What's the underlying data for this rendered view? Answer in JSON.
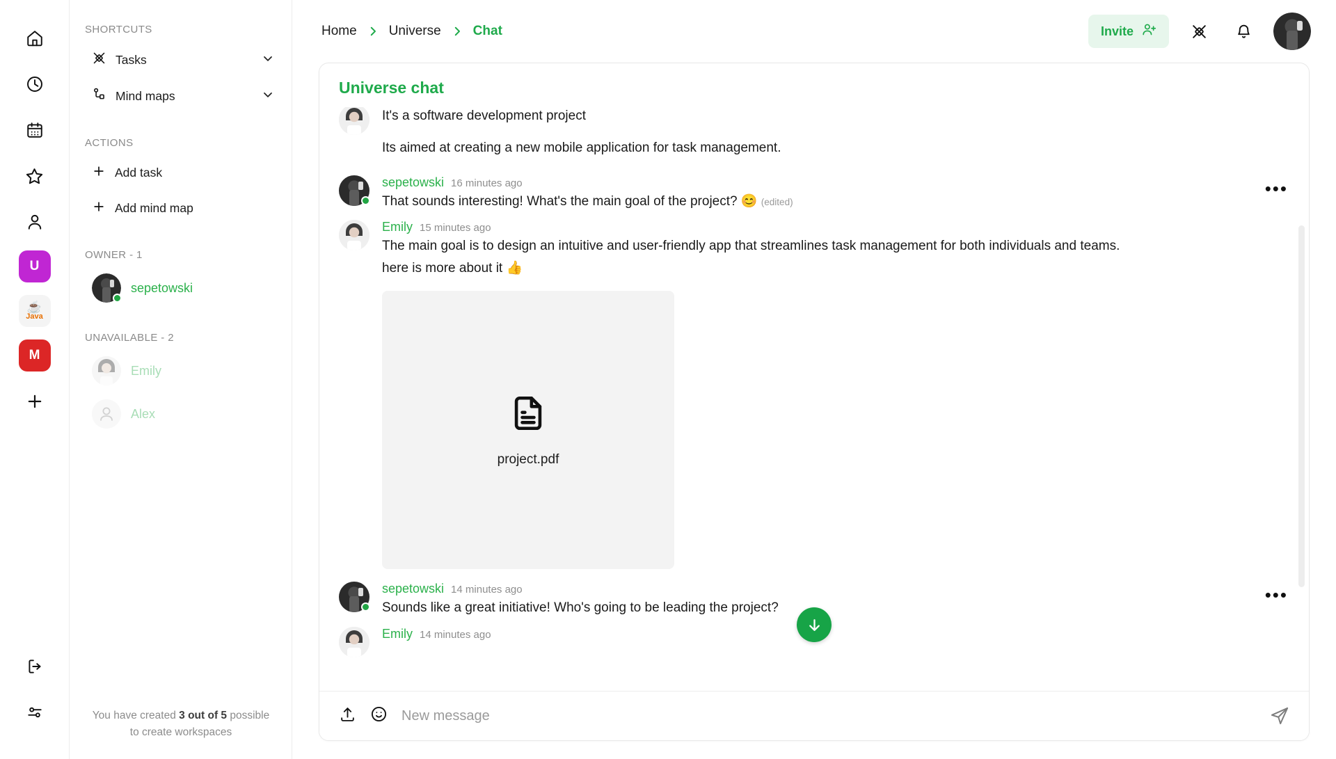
{
  "rail": {
    "icons": [
      {
        "name": "home-icon",
        "label": "Home"
      },
      {
        "name": "clock-icon",
        "label": "Recent"
      },
      {
        "name": "calendar-icon",
        "label": "Calendar"
      },
      {
        "name": "star-icon",
        "label": "Starred"
      },
      {
        "name": "user-icon",
        "label": "Profile"
      }
    ],
    "workspaces": [
      {
        "name": "workspace-u",
        "initial": "U",
        "color": "#c026d3"
      },
      {
        "name": "workspace-java",
        "initial": "Java",
        "color": "#f4f4f4"
      },
      {
        "name": "workspace-m",
        "initial": "M",
        "color": "#dc2626"
      }
    ],
    "add_label": "+",
    "bottom": [
      {
        "name": "logout-icon",
        "label": "Logout"
      },
      {
        "name": "settings-sliders-icon",
        "label": "Settings"
      }
    ]
  },
  "sidebar": {
    "shortcuts_label": "SHORTCUTS",
    "shortcuts": [
      {
        "label": "Tasks",
        "icon": "tasks-icon"
      },
      {
        "label": "Mind maps",
        "icon": "mind-map-icon"
      }
    ],
    "actions_label": "ACTIONS",
    "actions": [
      {
        "label": "Add task"
      },
      {
        "label": "Add mind map"
      }
    ],
    "owner_label": "OWNER - 1",
    "owner": [
      {
        "name": "sepetowski",
        "online": true
      }
    ],
    "unavailable_label": "UNAVAILABLE - 2",
    "unavailable": [
      {
        "name": "Emily",
        "online": false
      },
      {
        "name": "Alex",
        "online": false
      }
    ],
    "workspace_note_prefix": "You have created ",
    "workspace_note_count": "3 out of 5",
    "workspace_note_suffix": " possible to create workspaces"
  },
  "topbar": {
    "breadcrumbs": [
      {
        "label": "Home",
        "active": false
      },
      {
        "label": "Universe",
        "active": false
      },
      {
        "label": "Chat",
        "active": true
      }
    ],
    "invite_label": "Invite",
    "icons": [
      "user-plus-icon",
      "tasks-icon",
      "bell-icon"
    ],
    "accent": "#1faa4b"
  },
  "chat": {
    "title": "Universe chat",
    "messages": [
      {
        "user": "",
        "time": "",
        "text": "It's a software development project",
        "continued": false,
        "partial_top": true,
        "online": false,
        "menu": false
      },
      {
        "user": "",
        "time": "",
        "text": "Its aimed at creating a new mobile application for task management.",
        "continued": true,
        "online": false,
        "menu": false
      },
      {
        "user": "sepetowski",
        "time": "16 minutes ago",
        "text": "That sounds interesting! What's the main goal of the project? 😊",
        "edited": "(edited)",
        "continued": false,
        "online": true,
        "menu": true
      },
      {
        "user": "Emily",
        "time": "15 minutes ago",
        "text": "The main goal is to design an intuitive and user-friendly app that streamlines task management for both individuals and teams.",
        "text2": "here is more about it 👍",
        "continued": false,
        "online": false,
        "menu": false,
        "attachment": {
          "filename": "project.pdf",
          "icon": "file-document-icon"
        }
      },
      {
        "user": "sepetowski",
        "time": "14 minutes ago",
        "text": "Sounds like a great initiative! Who's going to be leading the project?",
        "continued": false,
        "online": true,
        "menu": true
      },
      {
        "user": "Emily",
        "time": "14 minutes ago",
        "text": "",
        "continued": false,
        "online": false,
        "menu": false
      }
    ],
    "scroll_down_icon": "arrow-down-icon",
    "composer": {
      "placeholder": "New message",
      "upload_icon": "upload-icon",
      "emoji_icon": "emoji-smile-icon",
      "send_icon": "send-icon"
    }
  }
}
